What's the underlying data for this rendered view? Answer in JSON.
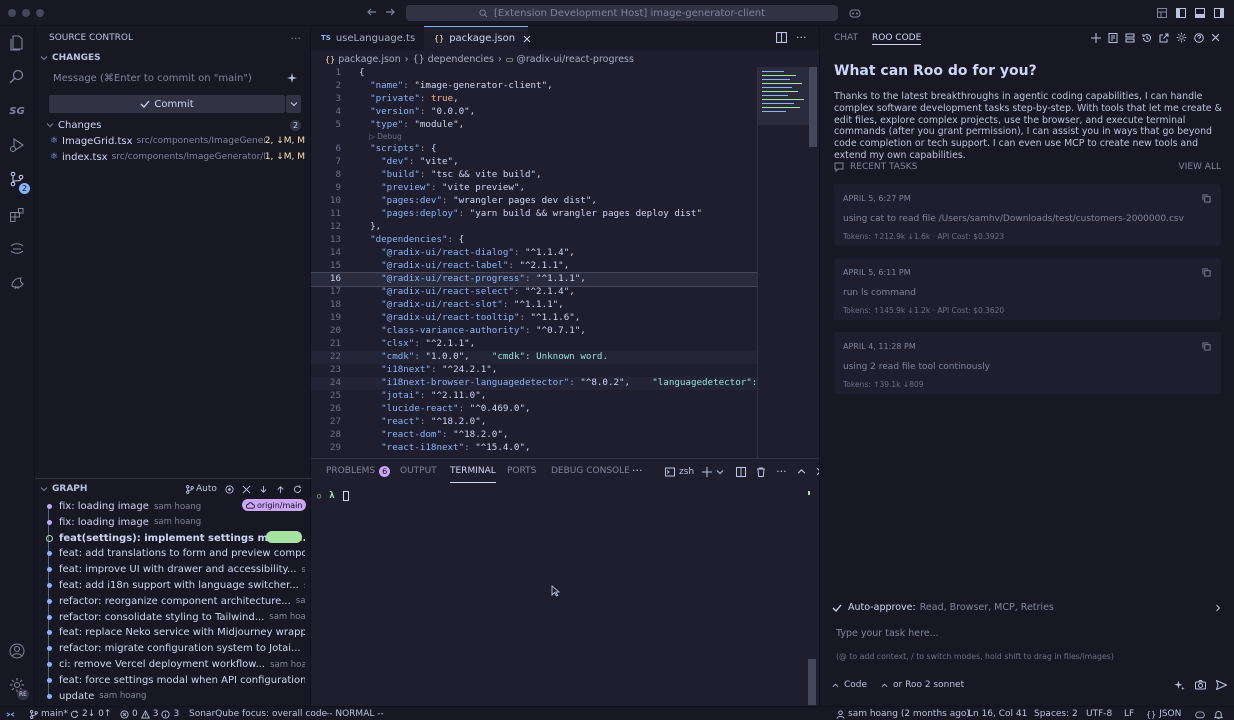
{
  "titlebar": {
    "command_center": "[Extension Development Host] image-generator-client"
  },
  "activity": {
    "scm_badge": "2",
    "account_label": "RE"
  },
  "source_control": {
    "title": "SOURCE CONTROL",
    "changes_header": "CHANGES",
    "commit_placeholder": "Message (⌘Enter to commit on \"main\")",
    "commit_label": "Commit",
    "changes_group": "Changes",
    "changes_count": "2",
    "files": [
      {
        "name": "ImageGrid.tsx",
        "path": "src/components/ImageGenerat...",
        "status": "2, ↓M, M"
      },
      {
        "name": "index.tsx",
        "path": "src/components/ImageGenerator/Im...",
        "status": "1, ↓M, M"
      }
    ]
  },
  "graph": {
    "title": "GRAPH",
    "auto_label": "Auto",
    "origin_badge": "origin/main",
    "commits": [
      {
        "msg": "fix: loading image",
        "author": "sam hoang"
      },
      {
        "msg": "fix: loading image",
        "author": "sam hoang"
      },
      {
        "msg": "feat(settings): implement settings manage...",
        "author": ""
      },
      {
        "msg": "feat: add translations to form and preview component...",
        "author": ""
      },
      {
        "msg": "feat: improve UI with drawer and accessibility...",
        "author": "sam h..."
      },
      {
        "msg": "feat: add i18n support with language switcher...",
        "author": "sam h..."
      },
      {
        "msg": "refactor: reorganize component architecture...",
        "author": "sam ho..."
      },
      {
        "msg": "refactor: consolidate styling to Tailwind...",
        "author": "sam hoang"
      },
      {
        "msg": "feat: replace Neko service with Midjourney wrapper......",
        "author": ""
      },
      {
        "msg": "refactor: migrate configuration system to Jotai...",
        "author": "sam h..."
      },
      {
        "msg": "ci: remove Vercel deployment workflow...",
        "author": "sam hoang"
      },
      {
        "msg": "feat: force settings modal when API configuration is mi...",
        "author": ""
      },
      {
        "msg": "update",
        "author": "sam hoang"
      }
    ]
  },
  "editor": {
    "tabs": [
      {
        "icon": "TS",
        "label": "useLanguage.ts"
      },
      {
        "icon": "{}",
        "label": "package.json"
      }
    ],
    "breadcrumb": [
      "package.json",
      "{} dependencies",
      "@radix-ui/react-progress"
    ],
    "codelens": "Debug",
    "lines": [
      {
        "n": "1",
        "t": "{"
      },
      {
        "n": "2",
        "t": "  \"name\": \"image-generator-client\","
      },
      {
        "n": "3",
        "t": "  \"private\": true,"
      },
      {
        "n": "4",
        "t": "  \"version\": \"0.0.0\","
      },
      {
        "n": "5",
        "t": "  \"type\": \"module\","
      },
      {
        "n": "6",
        "t": "  \"scripts\": {"
      },
      {
        "n": "7",
        "t": "    \"dev\": \"vite\","
      },
      {
        "n": "8",
        "t": "    \"build\": \"tsc && vite build\","
      },
      {
        "n": "9",
        "t": "    \"preview\": \"vite preview\","
      },
      {
        "n": "10",
        "t": "    \"pages:dev\": \"wrangler pages dev dist\","
      },
      {
        "n": "11",
        "t": "    \"pages:deploy\": \"yarn build && wrangler pages deploy dist\""
      },
      {
        "n": "12",
        "t": "  },"
      },
      {
        "n": "13",
        "t": "  \"dependencies\": {"
      },
      {
        "n": "14",
        "t": "    \"@radix-ui/react-dialog\": \"^1.1.4\","
      },
      {
        "n": "15",
        "t": "    \"@radix-ui/react-label\": \"^2.1.1\","
      },
      {
        "n": "16",
        "t": "    \"@radix-ui/react-progress\": \"^1.1.1\","
      },
      {
        "n": "17",
        "t": "    \"@radix-ui/react-select\": \"^2.1.4\","
      },
      {
        "n": "18",
        "t": "    \"@radix-ui/react-slot\": \"^1.1.1\","
      },
      {
        "n": "19",
        "t": "    \"@radix-ui/react-tooltip\": \"^1.1.6\","
      },
      {
        "n": "20",
        "t": "    \"class-variance-authority\": \"^0.7.1\","
      },
      {
        "n": "21",
        "t": "    \"clsx\": \"^2.1.1\","
      },
      {
        "n": "22",
        "t": "    \"cmdk\": \"1.0.0\",    \"cmdk\": Unknown word."
      },
      {
        "n": "23",
        "t": "    \"i18next\": \"^24.2.1\","
      },
      {
        "n": "24",
        "t": "    \"i18next-browser-languagedetector\": \"^8.0.2\",    \"languagedetector\": Unk"
      },
      {
        "n": "25",
        "t": "    \"jotai\": \"^2.11.0\","
      },
      {
        "n": "26",
        "t": "    \"lucide-react\": \"^0.469.0\","
      },
      {
        "n": "27",
        "t": "    \"react\": \"^18.2.0\","
      },
      {
        "n": "28",
        "t": "    \"react-dom\": \"^18.2.0\","
      },
      {
        "n": "29",
        "t": "    \"react-i18next\": \"^15.4.0\","
      }
    ]
  },
  "panel": {
    "tabs": [
      "PROBLEMS",
      "OUTPUT",
      "TERMINAL",
      "PORTS",
      "DEBUG CONSOLE"
    ],
    "problems_badge": "6",
    "shell": "zsh",
    "prompt": "λ"
  },
  "roo": {
    "tabs": [
      "CHAT",
      "ROO CODE"
    ],
    "heading": "What can Roo do for you?",
    "intro": "Thanks to the latest breakthroughs in agentic coding capabilities, I can handle complex software development tasks step-by-step. With tools that let me create & edit files, explore complex projects, use the browser, and execute terminal commands (after you grant permission), I can assist you in ways that go beyond code completion or tech support. I can even use MCP to create new tools and extend my own capabilities.",
    "recent_label": "RECENT TASKS",
    "view_all": "VIEW ALL",
    "tasks": [
      {
        "date": "APRIL 5, 6:27 PM",
        "text": "using cat to read file /Users/samhv/Downloads/test/customers-2000000.csv",
        "meta": "Tokens: ↑212.9k ↓1.6k · API Cost: $0.3923"
      },
      {
        "date": "APRIL 5, 6:11 PM",
        "text": "run ls command",
        "meta": "Tokens: ↑145.9k ↓1.2k · API Cost: $0.3620"
      },
      {
        "date": "APRIL 4, 11:28 PM",
        "text": "using 2 read file tool continously",
        "meta": "Tokens: ↑39.1k ↓809"
      }
    ],
    "auto_approve_label": "Auto-approve:",
    "auto_approve_items": "Read, Browser, MCP, Retries",
    "input_placeholder": "Type your task here...",
    "input_hint": "(@ to add context, / to switch modes, hold shift to drag in files/images)",
    "mode": "Code",
    "model": "or Roo 2 sonnet"
  },
  "status": {
    "branch": "main*",
    "sync": "2↓ 0↑",
    "errors": "0",
    "warnings": "3",
    "info": "3",
    "sonar": "SonarQube focus: overall code",
    "vim": "-- NORMAL --",
    "blame": "sam hoang (2 months ago)",
    "cursor": "Ln 16, Col 41",
    "spaces": "Spaces: 2",
    "encoding": "UTF-8",
    "eol": "LF",
    "language": "JSON"
  },
  "colors": {
    "accent": "#89b4fa",
    "success": "#a6e3a1",
    "badge": "#cba6f7",
    "bg": "#1e1e2e",
    "panel": "#181825"
  }
}
